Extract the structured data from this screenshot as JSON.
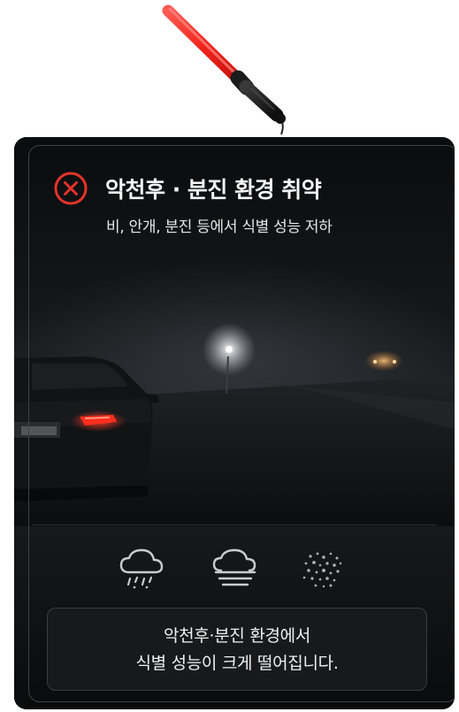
{
  "header": {
    "icon": "close-circle-icon",
    "title": "악천후 · 분진 환경 취약",
    "subtitle": "비, 안개, 분진 등에서 식별 성능 저하"
  },
  "conditions": [
    {
      "name": "rain",
      "icon": "rain-cloud-icon"
    },
    {
      "name": "fog",
      "icon": "fog-cloud-icon"
    },
    {
      "name": "dust",
      "icon": "dust-particles-icon"
    }
  ],
  "message": {
    "line1": "악천후·분진 환경에서",
    "line2": "식별 성능이 크게 떨어집니다."
  },
  "colors": {
    "accent_red": "#e5332a",
    "background": "#0c0d0f",
    "text": "#f5f5f5",
    "icon_gray": "#c9ccd0"
  }
}
